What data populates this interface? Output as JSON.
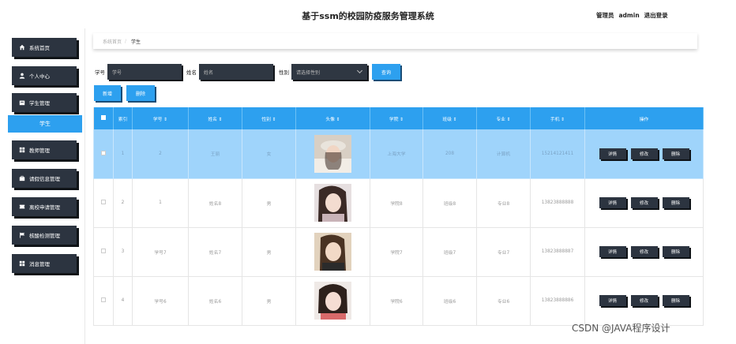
{
  "header": {
    "title": "基于ssm的校园防疫服务管理系统",
    "user_role": "管理员",
    "user_name": "admin",
    "logout": "退出登录"
  },
  "sidebar": {
    "items": [
      {
        "label": "系统首页",
        "icon": "home-icon"
      },
      {
        "label": "个人中心",
        "icon": "user-icon"
      },
      {
        "label": "学生管理",
        "icon": "folder-icon"
      },
      {
        "label": "教师管理",
        "icon": "grid-icon"
      },
      {
        "label": "请假信息管理",
        "icon": "briefcase-icon"
      },
      {
        "label": "离校申请管理",
        "icon": "ticket-icon"
      },
      {
        "label": "核酸检测管理",
        "icon": "flag-icon"
      },
      {
        "label": "消息管理",
        "icon": "grid-icon"
      }
    ],
    "active_sub": "学生"
  },
  "breadcrumb": {
    "home": "系统首页",
    "current": "学生"
  },
  "filters": {
    "xuehao_label": "学号",
    "xuehao_placeholder": "学号",
    "xingming_label": "姓名",
    "xingming_placeholder": "姓名",
    "xingbie_label": "性别",
    "xingbie_placeholder": "请选择性别",
    "query": "查询"
  },
  "actions": {
    "add": "新增",
    "delete": "删除"
  },
  "table": {
    "columns": [
      "索引",
      "学号 ⇕",
      "姓名 ⇕",
      "性别 ⇕",
      "头像 ⇕",
      "学院 ⇕",
      "班级 ⇕",
      "专业 ⇕",
      "手机 ⇕",
      "操作"
    ],
    "rows": [
      {
        "index": "1",
        "xuehao": "2",
        "xingming": "王丽",
        "xingbie": "女",
        "xueyuan": "上海大学",
        "banji": "208",
        "zhuanye": "计算机",
        "shouji": "15214121411"
      },
      {
        "index": "2",
        "xuehao": "1",
        "xingming": "姓名8",
        "xingbie": "男",
        "xueyuan": "学院8",
        "banji": "班级8",
        "zhuanye": "专业8",
        "shouji": "13823888888"
      },
      {
        "index": "3",
        "xuehao": "学号7",
        "xingming": "姓名7",
        "xingbie": "男",
        "xueyuan": "学院7",
        "banji": "班级7",
        "zhuanye": "专业7",
        "shouji": "13823888887"
      },
      {
        "index": "4",
        "xuehao": "学号6",
        "xingming": "姓名6",
        "xingbie": "男",
        "xueyuan": "学院6",
        "banji": "班级6",
        "zhuanye": "专业6",
        "shouji": "13823888886"
      }
    ],
    "row_ops": {
      "detail": "详情",
      "edit": "修改",
      "delete": "删除"
    }
  },
  "watermark": "CSDN @JAVA程序设计",
  "colors": {
    "accent": "#2da0ef",
    "dark": "#2c3440",
    "selected_row": "#9fd4fb"
  }
}
